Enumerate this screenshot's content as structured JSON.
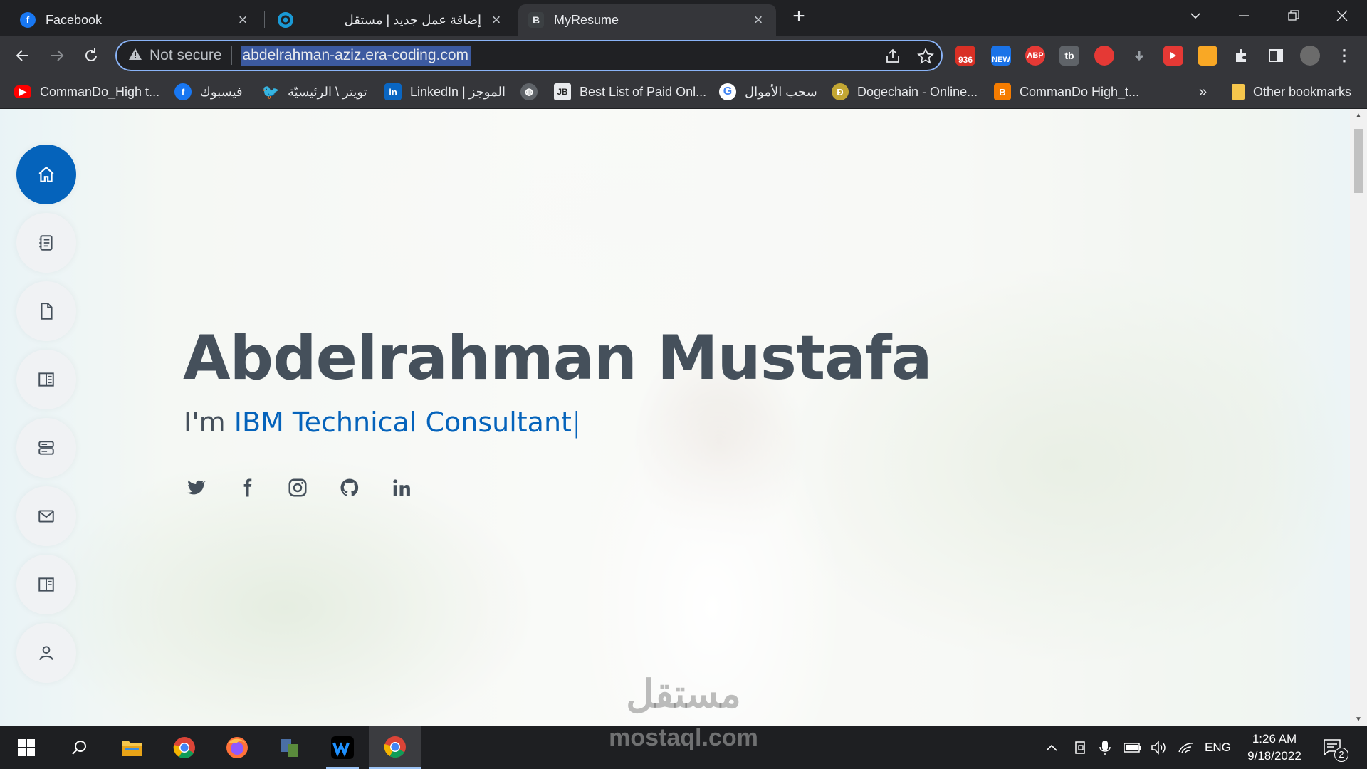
{
  "browser": {
    "tabs": [
      {
        "title": "Facebook",
        "favicon": "facebook-icon",
        "active": false
      },
      {
        "title": "إضافة عمل جديد | مستقل",
        "favicon": "mostaql-icon",
        "active": false
      },
      {
        "title": "MyResume",
        "favicon": "B",
        "active": true
      }
    ],
    "address": {
      "security": "Not secure",
      "url": "abdelrahman-aziz.era-coding.com"
    },
    "extensions": [
      {
        "name": "gmail-checker-extension",
        "badge": "936",
        "color": "#d93025"
      },
      {
        "name": "new-extension",
        "badge": "NEW",
        "color": "#1a73e8"
      },
      {
        "name": "adblock-plus-extension",
        "badge": "ABP",
        "color": "#e53935"
      },
      {
        "name": "tb-extension",
        "badge": "tb",
        "color": "#5f6368"
      },
      {
        "name": "hand-extension",
        "badge": "",
        "color": "#e53935"
      },
      {
        "name": "download-extension",
        "badge": "",
        "color": "#5f6368"
      },
      {
        "name": "video-extension",
        "badge": "",
        "color": "#e53935"
      },
      {
        "name": "coin-extension",
        "badge": "",
        "color": "#f9a825"
      }
    ],
    "bookmarks": [
      {
        "label": "CommanDo_High t...",
        "icon": "youtube-icon",
        "color": "#ff0000"
      },
      {
        "label": "فيسبوك",
        "icon": "facebook-icon",
        "color": "#1877f2"
      },
      {
        "label": "تويتر \\ الرئيسيّة",
        "icon": "twitter-icon",
        "color": "#1d9bf0"
      },
      {
        "label": "LinkedIn | الموجز",
        "icon": "linkedin-icon",
        "color": "#0a66c2"
      },
      {
        "label": "",
        "icon": "globe-icon",
        "color": "#5f6368"
      },
      {
        "label": "Best List of Paid Onl...",
        "icon": "jb-icon",
        "color": "#222222"
      },
      {
        "label": "سحب الأموال",
        "icon": "google-icon",
        "color": "#ffffff"
      },
      {
        "label": "Dogechain - Online...",
        "icon": "dogecoin-icon",
        "color": "#c2a633"
      },
      {
        "label": "CommanDo High_t...",
        "icon": "blogger-icon",
        "color": "#f57c00"
      }
    ],
    "overflow_label": "»",
    "other_bookmarks": "Other bookmarks"
  },
  "page": {
    "name": "Abdelrahman Mustafa",
    "intro_prefix": "I'm ",
    "typed_text": "IBM Technical Consultant",
    "cursor": "|",
    "nav": [
      "home-icon",
      "resume-icon",
      "file-icon",
      "portfolio-icon",
      "services-icon",
      "mail-icon",
      "book-icon",
      "person-icon"
    ],
    "social": [
      "twitter-icon",
      "facebook-icon",
      "instagram-icon",
      "github-icon",
      "linkedin-icon"
    ],
    "accent_color": "#0563bb",
    "text_color": "#45505b",
    "watermark_ar": "مستقل"
  },
  "taskbar": {
    "watermark": "mostaql.com",
    "language": "ENG",
    "time": "1:26 AM",
    "date": "9/18/2022",
    "notifications": "2"
  }
}
